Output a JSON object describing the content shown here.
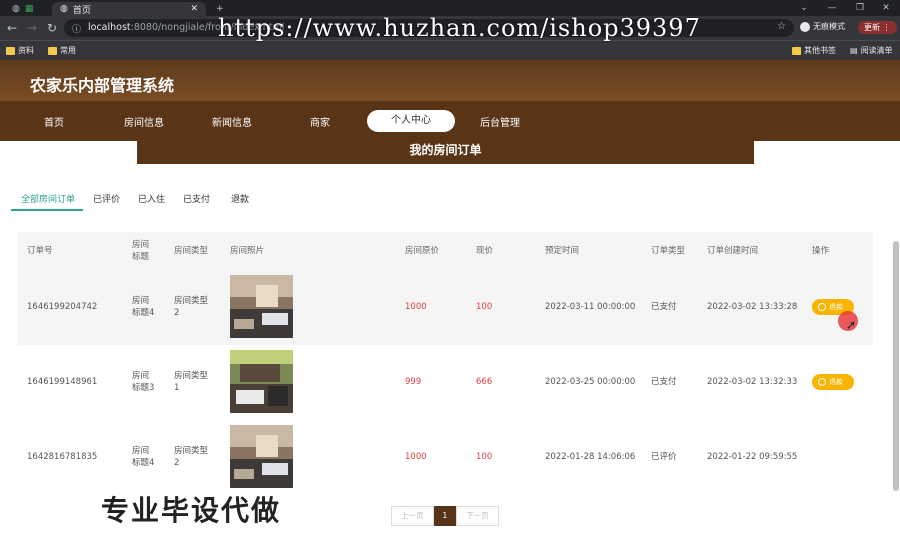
{
  "browser": {
    "tab_title": "首页",
    "url_host": "localhost",
    "url_rest": ":8080/nongjiale/front/index.html",
    "incognito_label": "无痕模式",
    "update_label": "更新",
    "bookmarks": [
      "资料",
      "常用"
    ],
    "bookmarks_right": [
      "其他书签",
      "阅读清单"
    ],
    "watermark": "https://www.huzhan.com/ishop39397"
  },
  "site": {
    "title": "农家乐内部管理系统",
    "nav": [
      "首页",
      "房间信息",
      "新闻信息",
      "商家",
      "个人中心",
      "后台管理"
    ],
    "active_nav": "个人中心"
  },
  "page": {
    "banner": "我的房间订单",
    "status_tabs": [
      "全部房间订单",
      "已评价",
      "已入住",
      "已支付",
      "退款"
    ],
    "active_status_tab": "全部房间订单"
  },
  "table": {
    "headers": [
      "订单号",
      "房间\n标题",
      "房间类型",
      "房间照片",
      "房间原价",
      "现价",
      "预定时间",
      "订单类型",
      "订单创建时间",
      "操作"
    ],
    "rows": [
      {
        "order_no": "1646199204742",
        "title": "房间\n标题4",
        "type": "房间类型\n2",
        "original_price": "1000",
        "price": "100",
        "book_time": "2022-03-11 00:00:00",
        "order_type": "已支付",
        "created": "2022-03-02 13:33:28",
        "action": "退款"
      },
      {
        "order_no": "1646199148961",
        "title": "房间\n标题3",
        "type": "房间类型\n1",
        "original_price": "999",
        "price": "666",
        "book_time": "2022-03-25 00:00:00",
        "order_type": "已支付",
        "created": "2022-03-02 13:32:33",
        "action": "退款"
      },
      {
        "order_no": "1642816781835",
        "title": "房间\n标题4",
        "type": "房间类型\n2",
        "original_price": "1000",
        "price": "100",
        "book_time": "2022-01-28 14:06:06",
        "order_type": "已评价",
        "created": "2022-01-22 09:59:55",
        "action": ""
      }
    ]
  },
  "pager": {
    "prev": "上一页",
    "current": "1",
    "next": "下一页"
  },
  "overlay_text": "专业毕设代做",
  "colors": {
    "brand": "#5a3417",
    "accent": "#2aa38f",
    "price": "#e04040",
    "button": "#f8b400"
  }
}
